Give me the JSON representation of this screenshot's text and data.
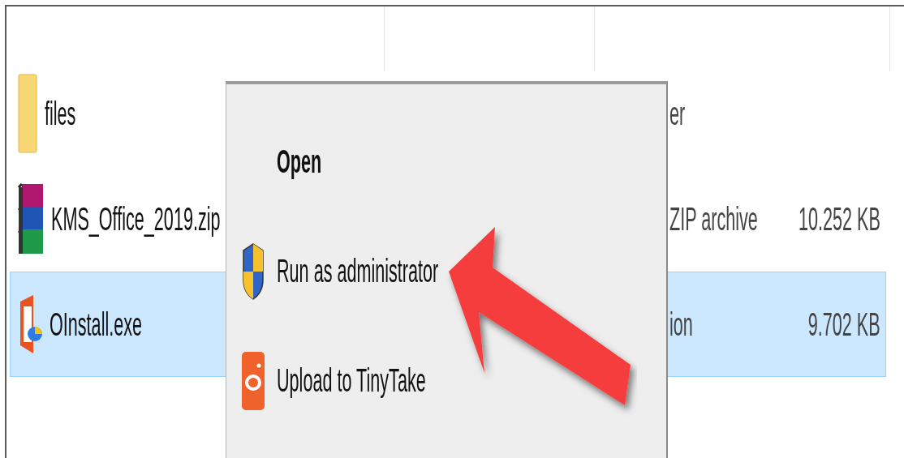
{
  "file_list": {
    "rows": [
      {
        "name": "files",
        "kind": "folder",
        "type": "er",
        "selected": false
      },
      {
        "name": "KMS_Office_2019.zip",
        "kind": "archive",
        "type": "ZIP archive",
        "size": "10.252 KB",
        "selected": false
      },
      {
        "name": "OInstall.exe",
        "kind": "office",
        "type": "ion",
        "size": "9.702 KB",
        "selected": true
      }
    ]
  },
  "context_menu": {
    "items": [
      {
        "label": "Open",
        "kind": "default"
      },
      {
        "label": "Run as administrator",
        "kind": "shield"
      },
      {
        "label": "Upload to TinyTake",
        "kind": "tinytake"
      }
    ]
  }
}
